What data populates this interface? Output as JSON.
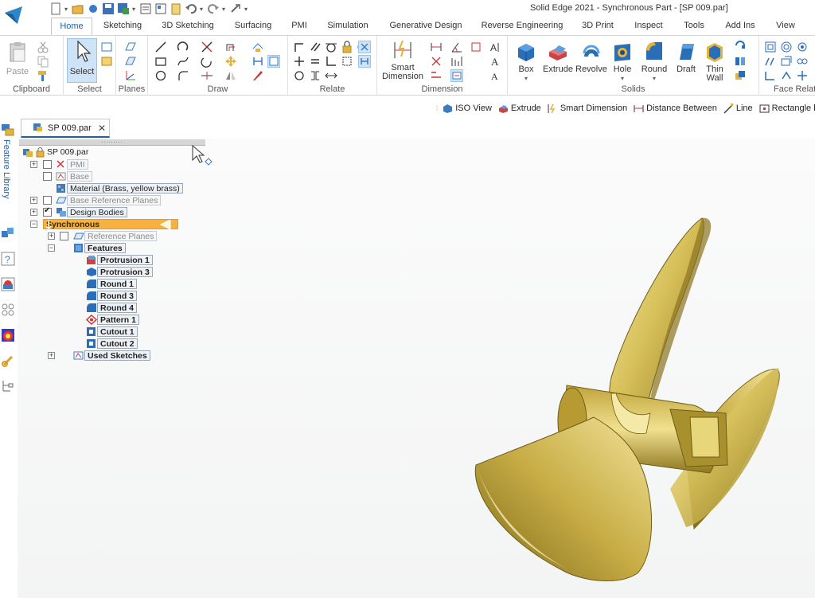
{
  "window": {
    "title": "Solid Edge 2021 - Synchronous Part - [SP 009.par]"
  },
  "quick_access": {
    "icons": [
      "new-icon",
      "open-icon",
      "close-icon",
      "save-icon",
      "save-as-icon",
      "print-icon",
      "undo-icon",
      "redo-icon",
      "customize-icon"
    ]
  },
  "tabs": [
    {
      "label": "Home"
    },
    {
      "label": "Sketching"
    },
    {
      "label": "3D Sketching"
    },
    {
      "label": "Surfacing"
    },
    {
      "label": "PMI"
    },
    {
      "label": "Simulation"
    },
    {
      "label": "Generative Design"
    },
    {
      "label": "Reverse Engineering"
    },
    {
      "label": "3D Print"
    },
    {
      "label": "Inspect"
    },
    {
      "label": "Tools"
    },
    {
      "label": "Add Ins"
    },
    {
      "label": "View"
    }
  ],
  "ribbon": {
    "clipboard": {
      "label": "Clipboard",
      "paste": "Paste"
    },
    "select": {
      "label": "Select",
      "select": "Select"
    },
    "planes": {
      "label": "Planes"
    },
    "draw": {
      "label": "Draw"
    },
    "relate": {
      "label": "Relate"
    },
    "dimension": {
      "label": "Dimension",
      "smart_1": "Smart",
      "smart_2": "Dimension"
    },
    "solids": {
      "label": "Solids",
      "box": "Box",
      "extrude": "Extrude",
      "revolve": "Revolve",
      "hole": "Hole",
      "round": "Round",
      "draft": "Draft",
      "thin_1": "Thin",
      "thin_2": "Wall"
    },
    "face_relate": {
      "label": "Face Relate"
    }
  },
  "command_bar": [
    {
      "label": "ISO View",
      "icon": "iso-view-icon"
    },
    {
      "label": "Extrude",
      "icon": "extrude-icon"
    },
    {
      "label": "Smart Dimension",
      "icon": "smart-dimension-icon"
    },
    {
      "label": "Distance Between",
      "icon": "distance-between-icon"
    },
    {
      "label": "Line",
      "icon": "line-icon"
    },
    {
      "label": "Rectangle by",
      "icon": "rectangle-icon"
    }
  ],
  "left_strip": {
    "feature_library": "Feature Library"
  },
  "document": {
    "tab": "SP 009.par",
    "close": "✕",
    "grip": "........."
  },
  "tree": {
    "root": "SP 009.par",
    "pmi": "PMI",
    "base": "Base",
    "material": "Material (Brass, yellow brass)",
    "base_ref": "Base Reference Planes",
    "design_bodies": "Design Bodies",
    "synchronous": "Synchronous",
    "ref_planes": "Reference Planes",
    "features": "Features",
    "protrusion1": "Protrusion 1",
    "protrusion3": "Protrusion 3",
    "round1": "Round 1",
    "round3": "Round 3",
    "round4": "Round 4",
    "pattern1": "Pattern 1",
    "cutout1": "Cutout 1",
    "cutout2": "Cutout 2",
    "used_sketches": "Used Sketches"
  },
  "colors": {
    "accent": "#1e5fa8",
    "synchronous_highlight": "#f7b141",
    "brass": "#d9c35a"
  }
}
